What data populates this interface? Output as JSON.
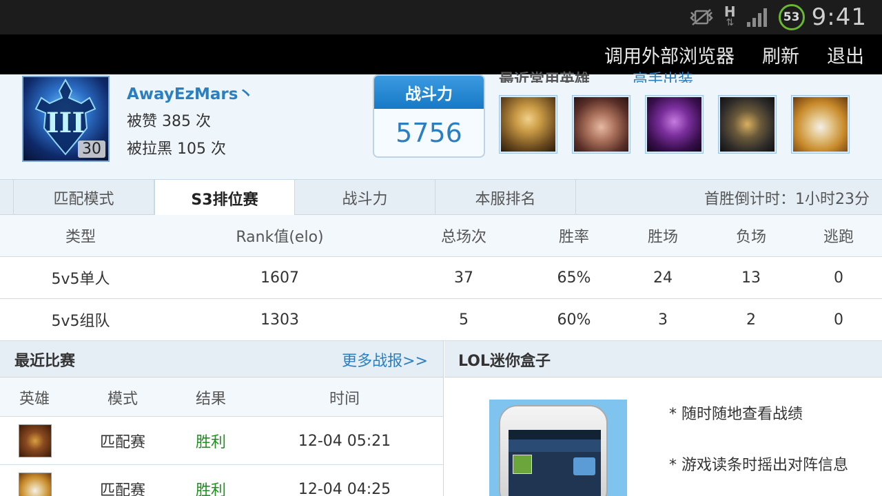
{
  "status_bar": {
    "battery": "53",
    "time": "9:41",
    "network_label": "H"
  },
  "action_bar": {
    "items": [
      "调用外部浏览器",
      "刷新",
      "退出"
    ]
  },
  "profile": {
    "username": "AwayEzMars丶",
    "level": "30",
    "praised": "被赞 385 次",
    "blacklisted": "被拉黑 105 次",
    "power_label": "战斗力",
    "power_value": "5756",
    "recent_heroes_label": "最近常用英雄",
    "recent_heroes_link": "高手出装",
    "heroes": [
      "hero-1",
      "hero-2",
      "hero-3",
      "hero-4",
      "hero-5"
    ]
  },
  "tabs": {
    "items": [
      "匹配模式",
      "S3排位赛",
      "战斗力",
      "本服排名"
    ],
    "active": "S3排位赛",
    "countdown": "首胜倒计时：1小时23分"
  },
  "rank_table": {
    "headers": [
      "类型",
      "Rank值(elo)",
      "总场次",
      "胜率",
      "胜场",
      "负场",
      "逃跑"
    ],
    "rows": [
      [
        "5v5单人",
        "1607",
        "37",
        "65%",
        "24",
        "13",
        "0"
      ],
      [
        "5v5组队",
        "1303",
        "5",
        "60%",
        "3",
        "2",
        "0"
      ]
    ]
  },
  "recent_matches": {
    "title": "最近比赛",
    "more": "更多战报>>",
    "headers": [
      "英雄",
      "模式",
      "结果",
      "时间"
    ],
    "rows": [
      {
        "mode": "匹配赛",
        "result": "胜利",
        "time": "12-04 05:21"
      },
      {
        "mode": "匹配赛",
        "result": "胜利",
        "time": "12-04 04:25"
      }
    ]
  },
  "mini_box": {
    "title": "LOL迷你盒子",
    "features": [
      "* 随时随地查看战绩",
      "* 游戏读条时摇出对阵信息"
    ]
  },
  "colors": {
    "link": "#2b7fc0",
    "win": "#1e8f1e",
    "header_bg": "#e6eef5"
  }
}
